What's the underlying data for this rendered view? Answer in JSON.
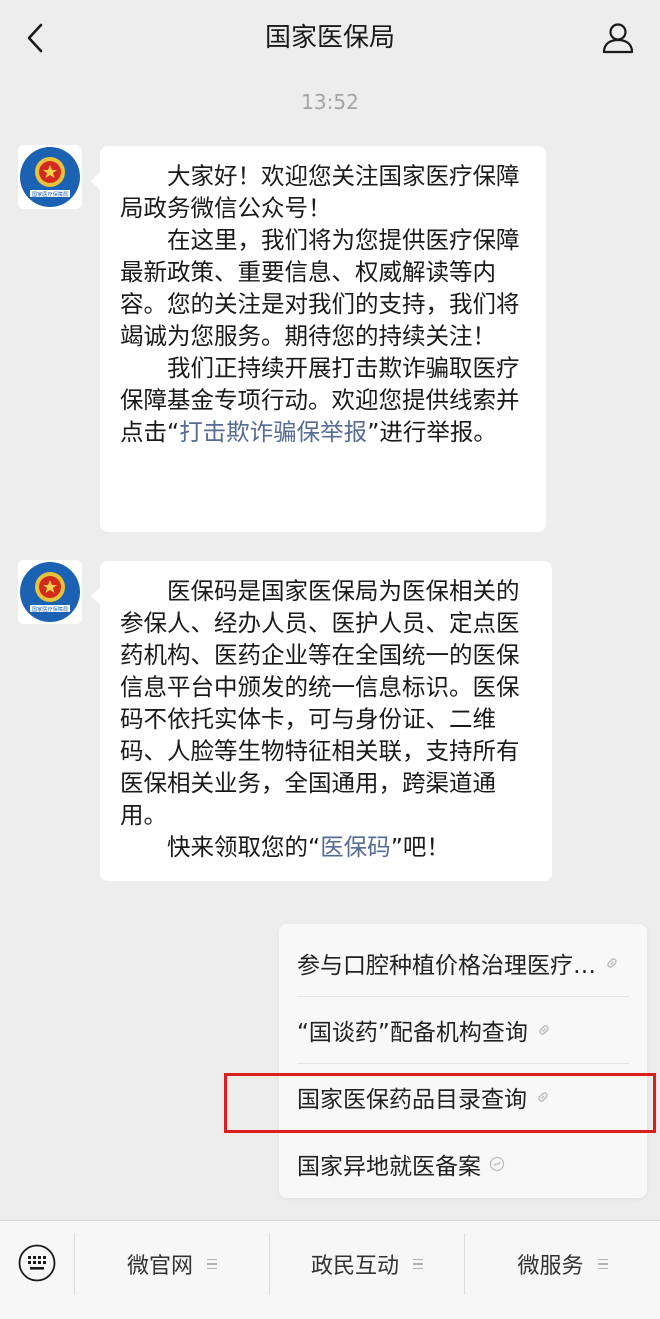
{
  "header": {
    "title": "国家医保局"
  },
  "chat": {
    "time": "13:52",
    "avatar_seal_text": "国家医疗保障局",
    "messages": [
      {
        "paragraphs": [
          {
            "text": "大家好！欢迎您关注国家医疗保障局政务微信公众号！"
          },
          {
            "text": "在这里，我们将为您提供医疗保障最新政策、重要信息、权威解读等内容。您的关注是对我们的支持，我们将竭诚为您服务。期待您的持续关注！"
          },
          {
            "before": "我们正持续开展打击欺诈骗取医疗保障基金专项行动。欢迎您提供线索并点击“",
            "link": "打击欺诈骗保举报",
            "after": "”进行举报。"
          }
        ]
      },
      {
        "paragraphs": [
          {
            "text": "医保码是国家医保局为医保相关的参保人、经办人员、医护人员、定点医药机构、医药企业等在全国统一的医保信息平台中颁发的统一信息标识。医保码不依托实体卡，可与身份证、二维码、人脸等生物特征相关联，支持所有医保相关业务，全国通用，跨渠道通用。"
          },
          {
            "before": "快来领取您的“",
            "link": "医保码",
            "after": "”吧！"
          }
        ]
      }
    ]
  },
  "service_menu": {
    "items": [
      {
        "label": "参与口腔种植价格治理医疗…",
        "icon": "link-icon"
      },
      {
        "label": "“国谈药”配备机构查询",
        "icon": "link-icon"
      },
      {
        "label": "国家医保药品目录查询",
        "icon": "link-icon"
      },
      {
        "label": "国家异地就医备案",
        "icon": "miniprogram-icon"
      }
    ]
  },
  "bottom_menu": {
    "keyboard_icon": "keyboard-icon",
    "tabs": [
      {
        "label": "微官网"
      },
      {
        "label": "政民互动"
      },
      {
        "label": "微服务"
      }
    ]
  },
  "colors": {
    "link": "#576b95",
    "highlight": "#d9201c",
    "background": "#ededed"
  }
}
